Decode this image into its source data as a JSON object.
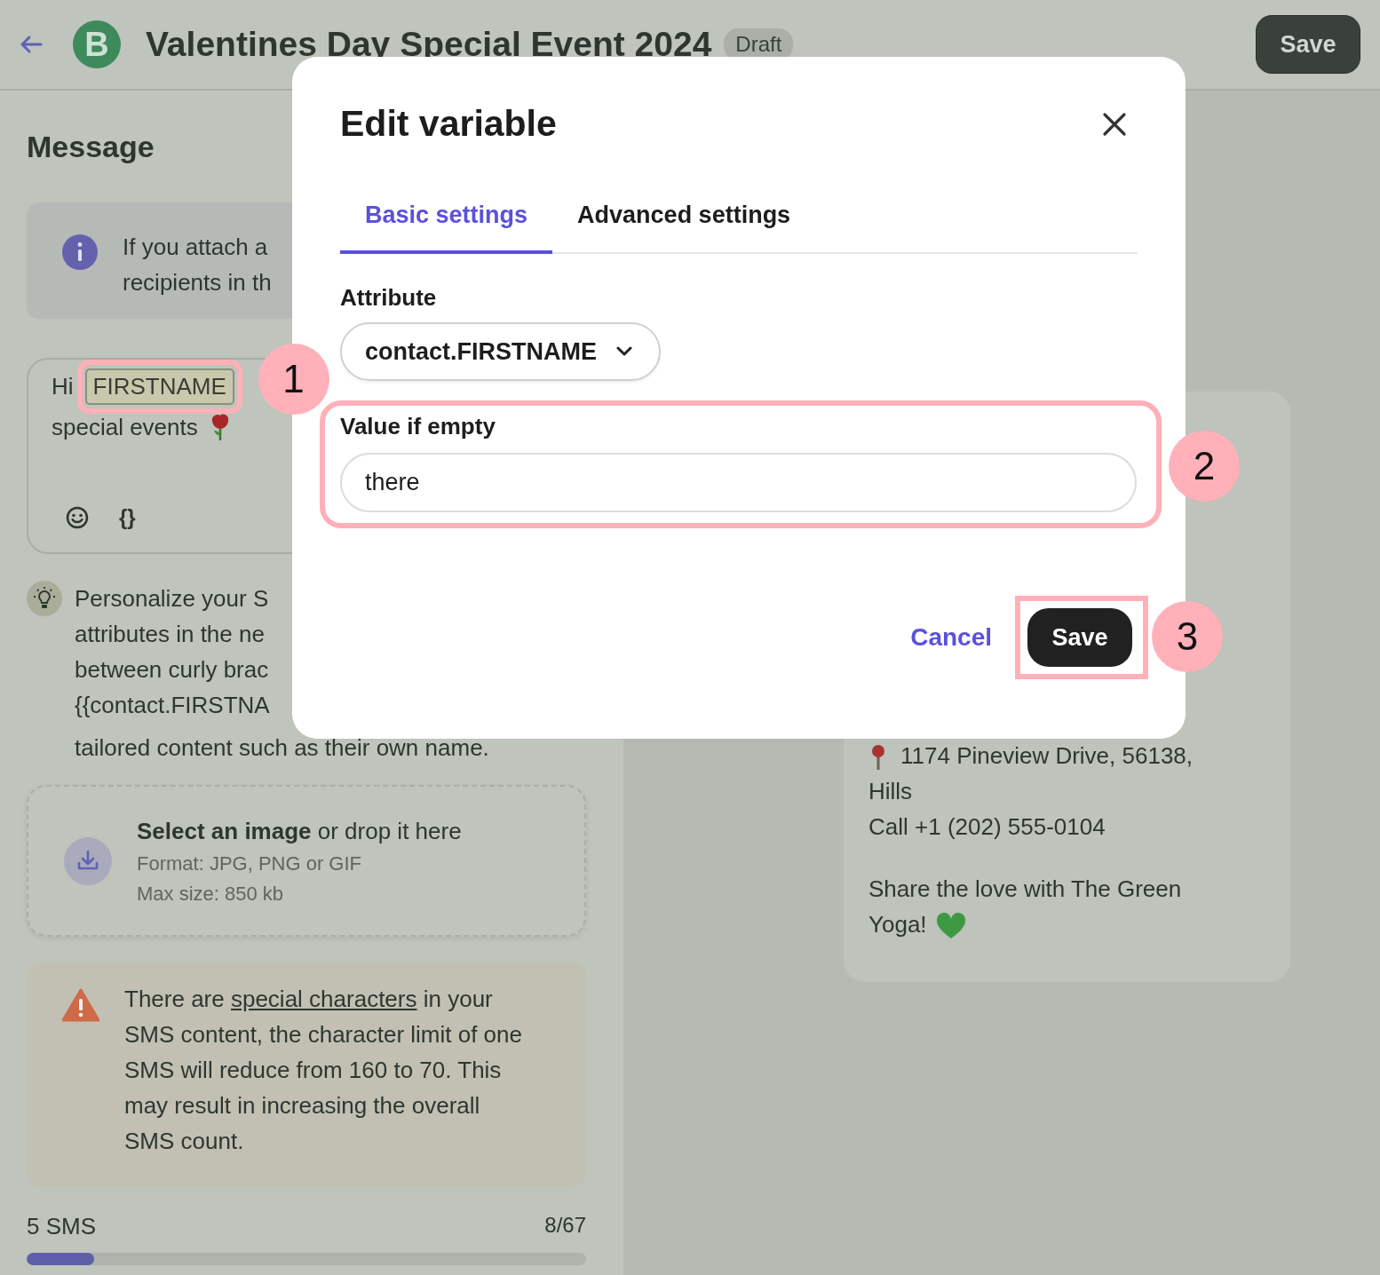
{
  "header": {
    "logo_letter": "B",
    "title": "Valentines Day Special Event 2024",
    "status": "Draft",
    "save_button": "Save"
  },
  "message_panel": {
    "heading": "Message",
    "info_lines": [
      "If you attach a",
      "recipients in th"
    ],
    "message": {
      "greeting": "Hi",
      "variable": "FIRSTNAME",
      "variable_callout": "1",
      "line_2": "special events",
      "variable_button": "{}"
    },
    "tip_lines": [
      "Personalize your S",
      "attributes in the ne",
      "between curly brac",
      "{{contact.FIRSTNA",
      "tailored content such as their own name."
    ],
    "upload": {
      "title": "**Select an image** or drop it here",
      "format": "Format: JPG, PNG or GIF",
      "max_size": "Max size: 850 kb"
    },
    "warning": {
      "before": "There are ",
      "link": "special characters",
      "after": " in your SMS content, the character limit of one SMS will reduce from 160 to 70. This may result in increasing the overall SMS count."
    },
    "sms_count": "5 SMS",
    "char_count": "8/67",
    "level": 0.12
  },
  "preview": {
    "lines": [
      {
        "text": "1174 Pineview Drive, 56138,",
        "kind": "address"
      },
      {
        "text": "Hills",
        "kind": "plain"
      },
      {
        "text": "Call +1 (202) 555-0104",
        "kind": "plain"
      },
      {
        "text": "Share the love with The Green",
        "kind": "paragraph"
      },
      {
        "text": "Yoga!",
        "kind": "closing"
      }
    ]
  },
  "modal": {
    "title": "Edit variable",
    "tabs": [
      {
        "label": "Basic settings",
        "selected": true
      },
      {
        "label": "Advanced settings",
        "selected": false
      }
    ],
    "attribute": {
      "label": "Attribute",
      "value": "contact.FIRSTNAME"
    },
    "fallback": {
      "label": "Value if empty",
      "value": "there",
      "callout": "2"
    },
    "cancel": "Cancel",
    "save": {
      "label": "Save",
      "callout": "3"
    }
  }
}
